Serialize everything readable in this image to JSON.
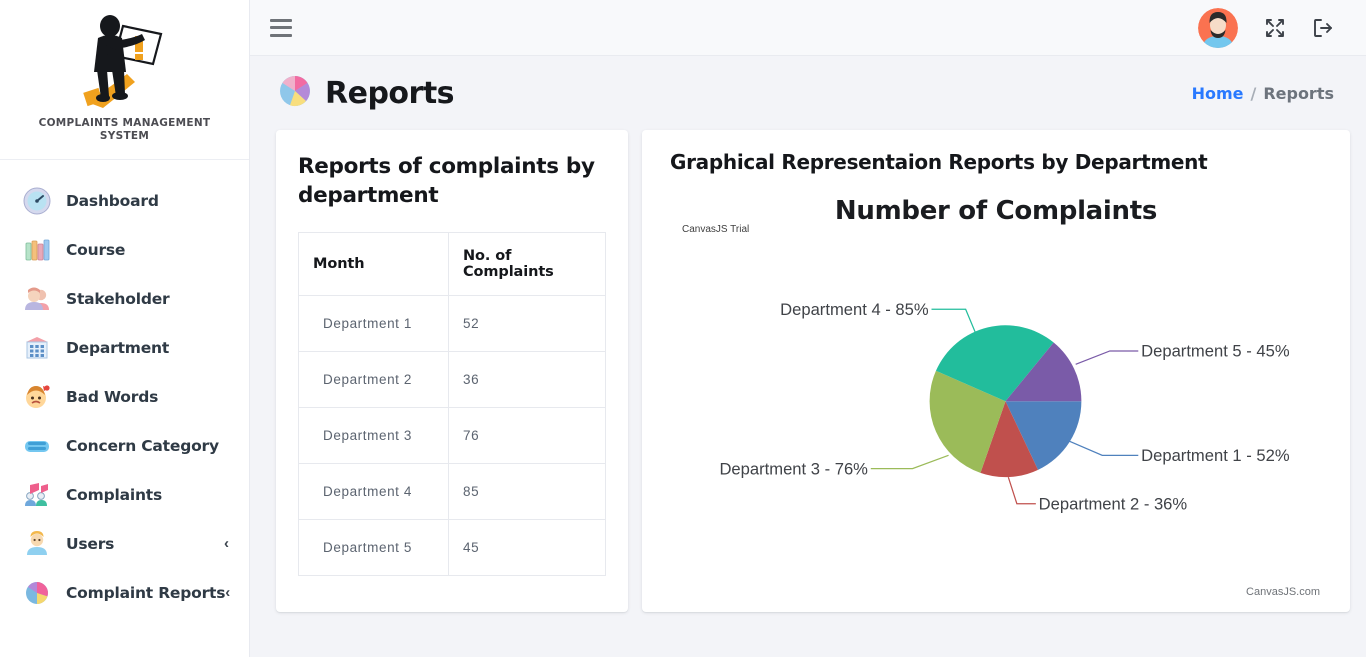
{
  "brand": {
    "name": "COMPLAINTS MANAGEMENT SYSTEM",
    "logo_icon": "complaint-person-logo"
  },
  "sidebar": {
    "items": [
      {
        "label": "Dashboard",
        "icon": "dashboard-gauge-icon",
        "caret": ""
      },
      {
        "label": "Course",
        "icon": "books-icon",
        "caret": ""
      },
      {
        "label": "Stakeholder",
        "icon": "people-icon",
        "caret": ""
      },
      {
        "label": "Department",
        "icon": "building-grid-icon",
        "caret": ""
      },
      {
        "label": "Bad Words",
        "icon": "angry-face-icon",
        "caret": ""
      },
      {
        "label": "Concern Category",
        "icon": "stacked-layers-icon",
        "caret": ""
      },
      {
        "label": "Complaints",
        "icon": "megaphone-people-icon",
        "caret": ""
      },
      {
        "label": "Users",
        "icon": "user-icon",
        "caret": "‹"
      },
      {
        "label": "Complaint Reports",
        "icon": "pie-chart-icon",
        "caret": "‹"
      }
    ]
  },
  "topbar": {
    "menu_toggle_icon": "hamburger-icon",
    "avatar_icon": "user-avatar",
    "fullscreen_icon": "expand-arrows-icon",
    "logout_icon": "logout-icon"
  },
  "pagehead": {
    "title": "Reports",
    "title_icon": "pie-chart-icon",
    "breadcrumb": {
      "home": "Home",
      "separator": "/",
      "current": "Reports"
    }
  },
  "left_card": {
    "title": "Reports of complaints by department",
    "table": {
      "headers": [
        "Month",
        "No. of Complaints"
      ],
      "rows": [
        {
          "month": "Department 1",
          "count": "52"
        },
        {
          "month": "Department 2",
          "count": "36"
        },
        {
          "month": "Department 3",
          "count": "76"
        },
        {
          "month": "Department 4",
          "count": "85"
        },
        {
          "month": "Department 5",
          "count": "45"
        }
      ]
    }
  },
  "right_card": {
    "title": "Graphical Representaion Reports by Department",
    "trial_watermark": "CanvasJS Trial",
    "attribution": "CanvasJS.com"
  },
  "chart_data": {
    "type": "pie",
    "title": "Number of Complaints",
    "legend": "none",
    "grid": false,
    "labels": [
      "Department 1 - 52%",
      "Department 2 - 36%",
      "Department 3 - 76%",
      "Department 4 - 85%",
      "Department 5 - 45%"
    ],
    "categories": [
      "Department 1",
      "Department 2",
      "Department 3",
      "Department 4",
      "Department 5"
    ],
    "values": [
      52,
      36,
      76,
      85,
      45
    ],
    "colors": [
      "#4f81bd",
      "#c0504d",
      "#9bbb59",
      "#22bd9c",
      "#7a5ba8"
    ]
  }
}
